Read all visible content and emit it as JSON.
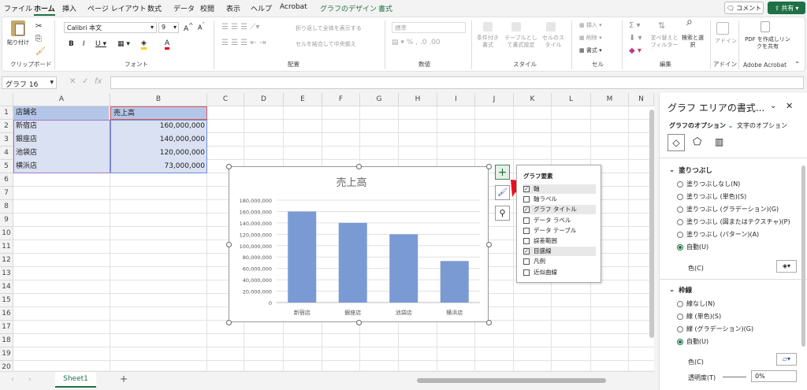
{
  "tabs": [
    "ファイル",
    "ホーム",
    "挿入",
    "ページ レイアウト",
    "数式",
    "データ",
    "校閲",
    "表示",
    "ヘルプ",
    "Acrobat",
    "グラフのデザイン",
    "書式"
  ],
  "active_tab": "ホーム",
  "comment_label": "コメント",
  "share_label": "共有",
  "ribbon": {
    "paste_label": "貼り付け",
    "clipboard_label": "クリップボード",
    "font_name": "Calibri 本文",
    "font_size": "9",
    "font_label": "フォント",
    "wrap_label": "折り返して全体を表示する",
    "merge_label": "セルを結合して中央揃え",
    "alignment_label": "配置",
    "number_format": "標準",
    "number_label": "数値",
    "cond_format": "条件付き書式",
    "table_format": "テーブルとして書式設定",
    "cell_style": "セルのスタイル",
    "style_label": "スタイル",
    "insert_label": "挿入",
    "delete_label": "削除",
    "format_label": "書式",
    "cells_label": "セル",
    "sort_label": "並べ替えとフィルター",
    "find_label": "検索と選択",
    "edit_label": "編集",
    "addin_label": "アドイン",
    "addin_group": "アドイン",
    "pdf_label": "PDF を作成しリンクを共有",
    "acrobat_group": "Adobe Acrobat"
  },
  "name_box": "グラフ 16",
  "columns": [
    "A",
    "B",
    "C",
    "D",
    "E",
    "F",
    "G",
    "H",
    "I",
    "J",
    "K",
    "L",
    "M",
    "N"
  ],
  "rows": [
    "1",
    "2",
    "3",
    "4",
    "5",
    "6",
    "7",
    "8",
    "9",
    "10",
    "11",
    "12",
    "13",
    "14",
    "15",
    "16",
    "17",
    "18",
    "19",
    "20"
  ],
  "table": {
    "header": [
      "店舗名",
      "売上高"
    ],
    "rows": [
      [
        "新宿店",
        "160,000,000"
      ],
      [
        "銀座店",
        "140,000,000"
      ],
      [
        "池袋店",
        "120,000,000"
      ],
      [
        "横浜店",
        "73,000,000"
      ]
    ]
  },
  "chart_data": {
    "type": "bar",
    "title": "売上高",
    "categories": [
      "新宿店",
      "銀座店",
      "池袋店",
      "横浜店"
    ],
    "values": [
      160000000,
      140000000,
      120000000,
      73000000
    ],
    "ylim": [
      0,
      180000000
    ],
    "yticks": [
      "0",
      "20,000,000",
      "40,000,000",
      "60,000,000",
      "80,000,000",
      "100,000,000",
      "120,000,000",
      "140,000,000",
      "160,000,000",
      "180,000,000"
    ],
    "color": "#7a9ad4",
    "grid": true
  },
  "chart_elements": {
    "title": "グラフ要素",
    "items": [
      {
        "label": "軸",
        "checked": true
      },
      {
        "label": "軸ラベル",
        "checked": false
      },
      {
        "label": "グラフ タイトル",
        "checked": true
      },
      {
        "label": "データ ラベル",
        "checked": false
      },
      {
        "label": "データ テーブル",
        "checked": false
      },
      {
        "label": "誤差範囲",
        "checked": false
      },
      {
        "label": "目盛線",
        "checked": true
      },
      {
        "label": "凡例",
        "checked": false
      },
      {
        "label": "近似曲線",
        "checked": false
      }
    ]
  },
  "sheet_tab": "Sheet1",
  "pane": {
    "title": "グラフ エリアの書式...",
    "tab_graph": "グラフのオプション",
    "tab_text": "文字のオプション",
    "fill_header": "塗りつぶし",
    "fill_options": [
      "塗りつぶしなし(N)",
      "塗りつぶし (単色)(S)",
      "塗りつぶし (グラデーション)(G)",
      "塗りつぶし (図またはテクスチャ)(P)",
      "塗りつぶし (パターン)(A)",
      "自動(U)"
    ],
    "fill_color": "色(C)",
    "line_header": "枠線",
    "line_options": [
      "線なし(N)",
      "線 (単色)(S)",
      "線 (グラデーション)(G)",
      "自動(U)"
    ],
    "line_color": "色(C)",
    "transparency": "透明度(T)",
    "transparency_value": "0%"
  }
}
